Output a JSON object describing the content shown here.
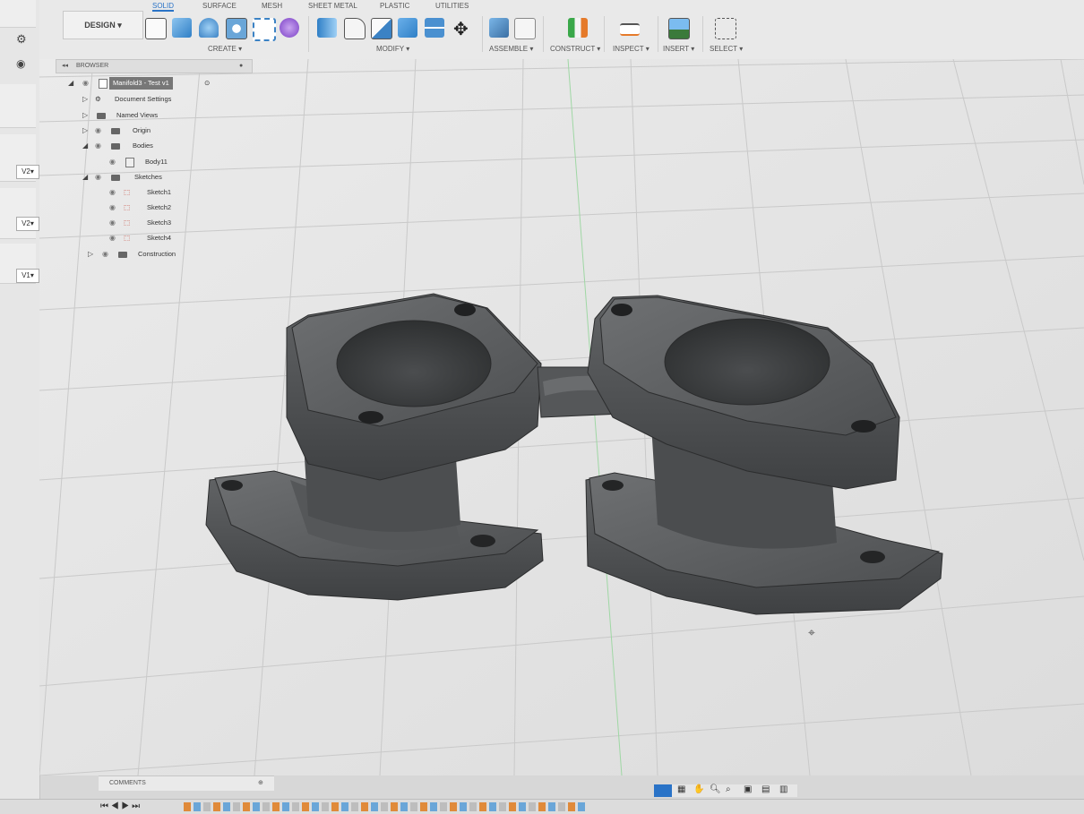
{
  "workspace": {
    "label": "DESIGN ▾"
  },
  "tabs": [
    "SOLID",
    "SURFACE",
    "MESH",
    "SHEET METAL",
    "PLASTIC",
    "UTILITIES"
  ],
  "groups": {
    "create": "CREATE ▾",
    "modify": "MODIFY ▾",
    "assemble": "ASSEMBLE ▾",
    "construct": "CONSTRUCT ▾",
    "inspect": "INSPECT ▾",
    "insert": "INSERT ▾",
    "select": "SELECT ▾"
  },
  "browser": {
    "title": "BROWSER",
    "root": "Manifold3 - Test v1",
    "items": {
      "doc": "Document Settings",
      "views": "Named Views",
      "origin": "Origin",
      "bodies": "Bodies",
      "body": "Body11",
      "sketches": "Sketches",
      "s1": "Sketch1",
      "s2": "Sketch2",
      "s3": "Sketch3",
      "s4": "Sketch4",
      "construction": "Construction"
    }
  },
  "versions": [
    "V2▾",
    "V2▾",
    "V1▾"
  ],
  "comments": {
    "label": "COMMENTS"
  },
  "colors": {
    "accent": "#2a73c7",
    "model": "#5a5c5e",
    "toolbar": "#e9e9e9"
  },
  "icons": [
    "collapse-icon",
    "eye-icon",
    "folder-icon",
    "gear-icon",
    "sketch-icon",
    "body-icon",
    "move-icon",
    "orbit-icon",
    "pan-icon",
    "zoom-icon",
    "display-icon",
    "grid-icon"
  ]
}
